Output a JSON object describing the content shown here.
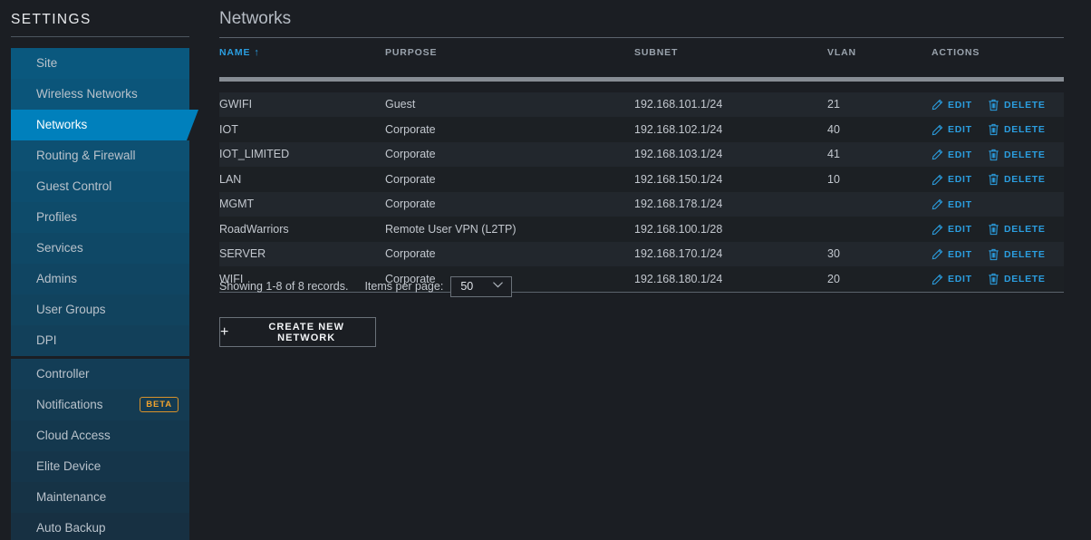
{
  "sidebar": {
    "header": "SETTINGS",
    "groups": [
      {
        "items": [
          {
            "label": "Site",
            "active": false
          },
          {
            "label": "Wireless Networks",
            "active": false
          },
          {
            "label": "Networks",
            "active": true
          },
          {
            "label": "Routing & Firewall",
            "active": false
          },
          {
            "label": "Guest Control",
            "active": false
          },
          {
            "label": "Profiles",
            "active": false
          },
          {
            "label": "Services",
            "active": false
          },
          {
            "label": "Admins",
            "active": false
          },
          {
            "label": "User Groups",
            "active": false
          },
          {
            "label": "DPI",
            "active": false
          }
        ]
      },
      {
        "items": [
          {
            "label": "Controller",
            "active": false
          },
          {
            "label": "Notifications",
            "active": false,
            "badge": "BETA"
          },
          {
            "label": "Cloud Access",
            "active": false
          },
          {
            "label": "Elite Device",
            "active": false
          },
          {
            "label": "Maintenance",
            "active": false
          },
          {
            "label": "Auto Backup",
            "active": false
          }
        ]
      }
    ]
  },
  "main": {
    "page_title": "Networks",
    "table": {
      "columns": [
        {
          "key": "name",
          "label": "NAME",
          "sorted": true,
          "sort_dir": "↑"
        },
        {
          "key": "purpose",
          "label": "PURPOSE",
          "sorted": false
        },
        {
          "key": "subnet",
          "label": "SUBNET",
          "sorted": false
        },
        {
          "key": "vlan",
          "label": "VLAN",
          "sorted": false
        },
        {
          "key": "actions",
          "label": "ACTIONS",
          "sorted": false
        }
      ],
      "edit_label": "EDIT",
      "delete_label": "DELETE",
      "rows": [
        {
          "name": "GWIFI",
          "purpose": "Guest",
          "subnet": "192.168.101.1/24",
          "vlan": "21",
          "can_edit": true,
          "can_delete": true
        },
        {
          "name": "IOT",
          "purpose": "Corporate",
          "subnet": "192.168.102.1/24",
          "vlan": "40",
          "can_edit": true,
          "can_delete": true
        },
        {
          "name": "IOT_LIMITED",
          "purpose": "Corporate",
          "subnet": "192.168.103.1/24",
          "vlan": "41",
          "can_edit": true,
          "can_delete": true
        },
        {
          "name": "LAN",
          "purpose": "Corporate",
          "subnet": "192.168.150.1/24",
          "vlan": "10",
          "can_edit": true,
          "can_delete": true
        },
        {
          "name": "MGMT",
          "purpose": "Corporate",
          "subnet": "192.168.178.1/24",
          "vlan": "",
          "can_edit": true,
          "can_delete": false
        },
        {
          "name": "RoadWarriors",
          "purpose": "Remote User VPN (L2TP)",
          "subnet": "192.168.100.1/28",
          "vlan": "",
          "can_edit": true,
          "can_delete": true
        },
        {
          "name": "SERVER",
          "purpose": "Corporate",
          "subnet": "192.168.170.1/24",
          "vlan": "30",
          "can_edit": true,
          "can_delete": true
        },
        {
          "name": "WIFI",
          "purpose": "Corporate",
          "subnet": "192.168.180.1/24",
          "vlan": "20",
          "can_edit": true,
          "can_delete": true
        }
      ]
    },
    "footer": {
      "records_text": "Showing 1-8 of 8 records.",
      "items_per_page_label": "Items per page:",
      "items_per_page_value": "50",
      "items_per_page_options": [
        "50"
      ],
      "create_button_label": "CREATE NEW NETWORK"
    }
  },
  "colors": {
    "accent_blue": "#2b9ee0",
    "active_nav": "#0080bc",
    "badge_orange": "#f0a32e",
    "page_bg": "#1b1e23"
  }
}
